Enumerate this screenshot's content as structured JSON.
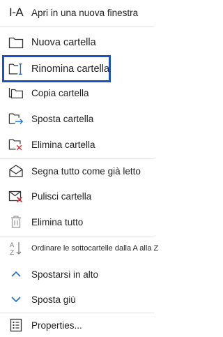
{
  "menu": {
    "items": [
      {
        "id": "open_new_window",
        "label": "Apri in una nuova finestra",
        "icon": "open-new-window-icon",
        "icon_text": "I-A"
      },
      {
        "id": "new_folder",
        "label": "Nuova cartella",
        "icon": "new-folder-icon"
      },
      {
        "id": "rename_folder",
        "label": "Rinomina cartella",
        "icon": "rename-folder-icon",
        "selected": true
      },
      {
        "id": "copy_folder",
        "label": "Copia cartella",
        "icon": "copy-folder-icon"
      },
      {
        "id": "move_folder",
        "label": "Sposta cartella",
        "icon": "move-folder-icon"
      },
      {
        "id": "delete_folder",
        "label": "Elimina cartella",
        "icon": "delete-folder-icon"
      },
      {
        "id": "mark_all_read",
        "label": "Segna tutto come già letto",
        "icon": "mark-read-envelope-icon"
      },
      {
        "id": "clean_folder",
        "label": "Pulisci cartella",
        "icon": "clean-folder-icon"
      },
      {
        "id": "delete_all",
        "label": "Elimina tutto",
        "icon": "trash-icon"
      },
      {
        "id": "sort_subfolders",
        "label": "Ordinare le sottocartelle dalla A alla Z",
        "icon": "sort-az-icon"
      },
      {
        "id": "move_up",
        "label": "Spostarsi in alto",
        "icon": "chevron-up-icon"
      },
      {
        "id": "move_down",
        "label": "Sposta giù",
        "icon": "chevron-down-icon"
      },
      {
        "id": "properties",
        "label": "Properties...",
        "icon": "properties-icon"
      }
    ]
  },
  "colors": {
    "selection_border": "#1a52c9",
    "accent_blue": "#1a6ed8",
    "delete_red": "#d13438",
    "text": "#1f1f1f",
    "divider": "#e1e1e1"
  }
}
